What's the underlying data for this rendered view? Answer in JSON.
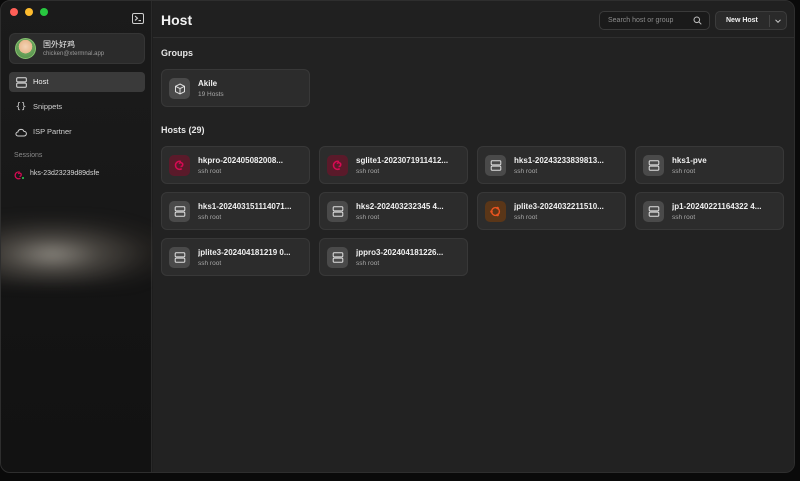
{
  "sidebar": {
    "profile": {
      "name": "国外好鸡",
      "email": "chicken@xtermnal.app"
    },
    "nav": [
      {
        "label": "Host",
        "icon": "server-icon",
        "active": true
      },
      {
        "label": "Snippets",
        "icon": "braces-icon",
        "active": false
      },
      {
        "label": "ISP Partner",
        "icon": "cloud-icon",
        "active": false
      }
    ],
    "sessions_title": "Sessions",
    "sessions": [
      {
        "label": "hks-23d23239d89dsfe",
        "icon": "debian-icon",
        "status_color": "#30d158"
      }
    ]
  },
  "header": {
    "title": "Host",
    "search_placeholder": "Search host or group",
    "new_host_label": "New Host"
  },
  "groups_title": "Groups",
  "groups": [
    {
      "name": "Akile",
      "count": "19 Hosts",
      "icon": "box-icon"
    }
  ],
  "hosts_title": "Hosts (29)",
  "hosts": [
    {
      "name": "hkpro-202405082008...",
      "sub": "ssh root",
      "icon": "debian"
    },
    {
      "name": "sglite1-2023071911412...",
      "sub": "ssh root",
      "icon": "debian"
    },
    {
      "name": "hks1-20243233839813...",
      "sub": "ssh root",
      "icon": "server"
    },
    {
      "name": "hks1-pve",
      "sub": "ssh root",
      "icon": "server"
    },
    {
      "name": "hks1-202403151114071...",
      "sub": "ssh root",
      "icon": "server"
    },
    {
      "name": "hks2-202403232345 4...",
      "sub": "ssh root",
      "icon": "server"
    },
    {
      "name": "jplite3-2024032211510...",
      "sub": "ssh root",
      "icon": "ubuntu"
    },
    {
      "name": "jp1-20240221164322 4...",
      "sub": "ssh root",
      "icon": "server"
    },
    {
      "name": "jplite3-202404181219 0...",
      "sub": "ssh root",
      "icon": "server"
    },
    {
      "name": "jppro3-202404181226...",
      "sub": "ssh root",
      "icon": "server"
    }
  ],
  "colors": {
    "accent": "#3a3a3a",
    "debian": "#d70a53",
    "ubuntu": "#e95420",
    "online": "#30d158"
  }
}
